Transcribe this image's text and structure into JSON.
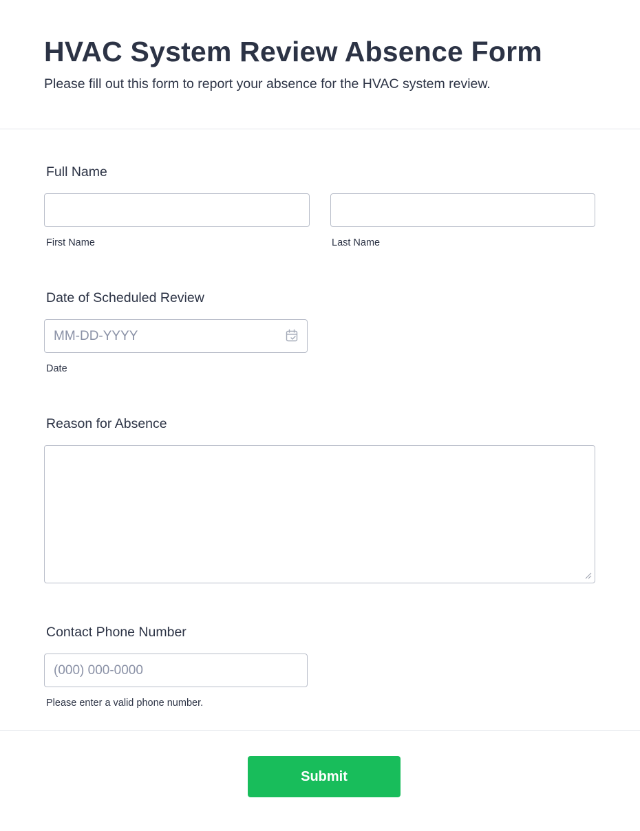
{
  "form": {
    "title": "HVAC System Review Absence Form",
    "subtitle": "Please fill out this form to report your absence for the HVAC system review."
  },
  "full_name": {
    "label": "Full Name",
    "first_value": "",
    "last_value": "",
    "first_sublabel": "First Name",
    "last_sublabel": "Last Name"
  },
  "review_date": {
    "label": "Date of Scheduled Review",
    "placeholder": "MM-DD-YYYY",
    "value": "",
    "sublabel": "Date",
    "icon": "calendar-icon"
  },
  "reason": {
    "label": "Reason for Absence",
    "value": "",
    "handle_icon": "resize-handle-icon"
  },
  "phone": {
    "label": "Contact Phone Number",
    "placeholder": "(000) 000-0000",
    "value": "",
    "sublabel": "Please enter a valid phone number."
  },
  "submit": {
    "label": "Submit"
  },
  "colors": {
    "text": "#2c3345",
    "placeholder": "#8a91a6",
    "border": "#b8bdc9",
    "divider": "#e3e5ea",
    "submit_bg": "#18bd5b",
    "submit_text": "#ffffff"
  }
}
